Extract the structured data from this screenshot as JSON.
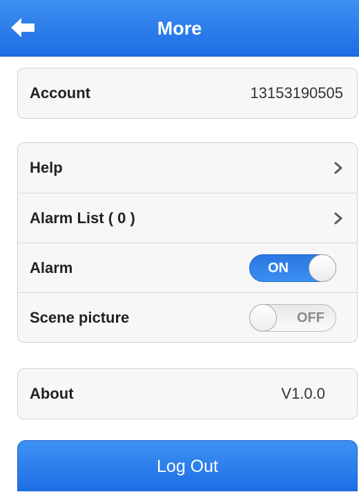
{
  "header": {
    "title": "More",
    "back_icon": "arrow-left-icon"
  },
  "account": {
    "label": "Account",
    "value": "13153190505"
  },
  "settings": {
    "help_label": "Help",
    "alarm_list_label": "Alarm List ( 0 )",
    "alarm_label": "Alarm",
    "alarm_toggle": "ON",
    "scene_picture_label": "Scene picture",
    "scene_picture_toggle": "OFF",
    "chevron_icon": "chevron-right-icon"
  },
  "about": {
    "label": "About",
    "value": "V1.0.0"
  },
  "footer": {
    "logout_label": "Log Out"
  },
  "colors": {
    "accent": "#1f6de6",
    "group_background": "#f7f7f7",
    "border": "#d2d2d2"
  }
}
